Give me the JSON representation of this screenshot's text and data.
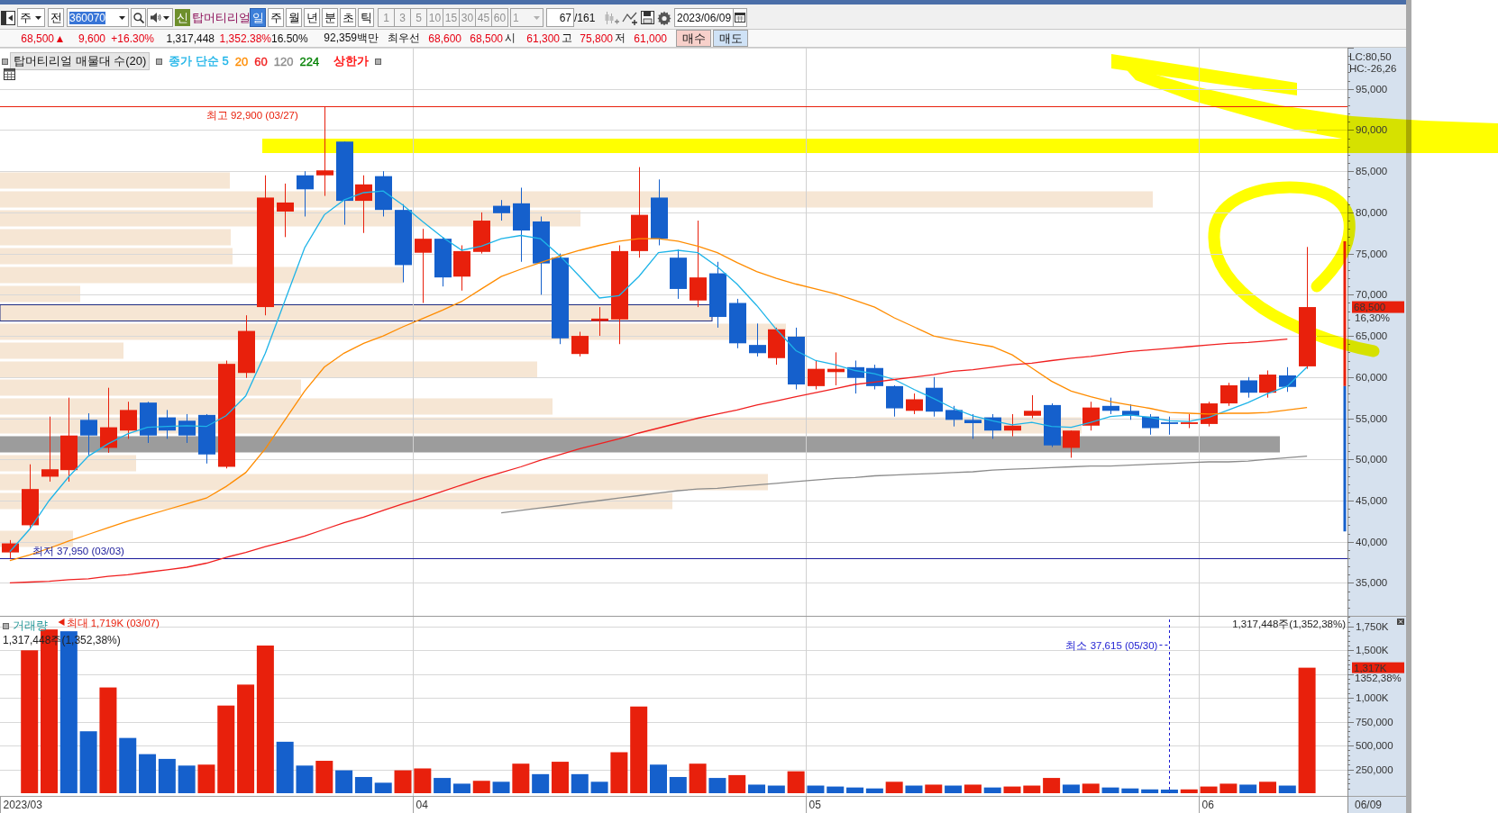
{
  "toolbar": {
    "market_dropdown": {
      "value": "주"
    },
    "full_button": {
      "label": "전"
    },
    "code_field": {
      "value": "360070",
      "text_selected": true
    },
    "badge": {
      "label": "신"
    },
    "stock_name": "탑머티리얼",
    "period_tabs": [
      {
        "label": "일",
        "selected": true
      },
      {
        "label": "주",
        "selected": false
      },
      {
        "label": "월",
        "selected": false
      },
      {
        "label": "년",
        "selected": false
      }
    ],
    "unit_tabs": [
      {
        "label": "분",
        "selected": false
      },
      {
        "label": "초",
        "selected": false
      },
      {
        "label": "틱",
        "selected": false
      }
    ],
    "interval_buttons": [
      {
        "label": "1",
        "disabled": true
      },
      {
        "label": "3",
        "disabled": true
      },
      {
        "label": "5",
        "disabled": true
      },
      {
        "label": "10",
        "disabled": true
      },
      {
        "label": "15",
        "disabled": true
      },
      {
        "label": "30",
        "disabled": true
      },
      {
        "label": "45",
        "disabled": true
      },
      {
        "label": "60",
        "disabled": true
      }
    ],
    "interval_dropdown": {
      "value": "1",
      "disabled": true
    },
    "count_field": {
      "value": "67"
    },
    "count_total": "/161",
    "date_field": {
      "value": "2023/06/09"
    }
  },
  "quote_bar": {
    "price": "68,500",
    "arrow": "▲",
    "change": "9,600",
    "change_rate": "+16.30%",
    "volume": "1,317,448",
    "volume_rate": "1,352.38%",
    "turnover_rate": "16.50%",
    "trade_amount": "92,359백만",
    "best_quote_label": "최우선",
    "best_ask": "68,600",
    "best_bid": "68,500",
    "open_label": "시",
    "open": "61,300",
    "high_label": "고",
    "high": "75,800",
    "low_label": "저",
    "low": "61,000",
    "buttons": [
      {
        "label": "매수",
        "kind": "buy"
      },
      {
        "label": "매도",
        "kind": "sell"
      }
    ]
  },
  "legend": {
    "overlay_label": "탑머티리얼 매물대 수(20)",
    "items": [
      {
        "label": "224",
        "color": "#008000"
      },
      {
        "label": "상한가",
        "color": "#ff0000"
      }
    ]
  },
  "price_chart": {
    "lc": "LC:80,50",
    "hc": "HC:-26,26",
    "price_tag": "68,500",
    "change_tag": "16,30%",
    "chart_data": {
      "type": "candlestick",
      "ylim": [
        31000,
        100000
      ],
      "grid": true,
      "yticks": [
        {
          "value": 35000,
          "label": "35,000"
        },
        {
          "value": 40000,
          "label": "40,000"
        },
        {
          "value": 45000,
          "label": "45,000"
        },
        {
          "value": 50000,
          "label": "50,000"
        },
        {
          "value": 55000,
          "label": "55,000"
        },
        {
          "value": 60000,
          "label": "60,000"
        },
        {
          "value": 65000,
          "label": "65,000"
        },
        {
          "value": 70000,
          "label": "70,000"
        },
        {
          "value": 75000,
          "label": "75,000"
        },
        {
          "value": 80000,
          "label": "80,000"
        },
        {
          "value": 85000,
          "label": "85,000"
        },
        {
          "value": 90000,
          "label": "90,000"
        },
        {
          "value": 95000,
          "label": "95,000"
        }
      ],
      "ohlc": [
        [
          38700,
          40200,
          37950,
          39800
        ],
        [
          42000,
          49400,
          41500,
          46400
        ],
        [
          47900,
          55200,
          47300,
          48800
        ],
        [
          48700,
          57500,
          47300,
          52900
        ],
        [
          54800,
          55600,
          50500,
          52900
        ],
        [
          51400,
          58700,
          50800,
          53900
        ],
        [
          53500,
          57000,
          52500,
          56000
        ],
        [
          56900,
          57000,
          52000,
          52900
        ],
        [
          55100,
          56000,
          52500,
          53500
        ],
        [
          54700,
          55500,
          52000,
          52900
        ],
        [
          55400,
          55500,
          49500,
          50600
        ],
        [
          49100,
          62000,
          48900,
          61600
        ],
        [
          60500,
          67500,
          59900,
          65600
        ],
        [
          68500,
          84500,
          67500,
          81800
        ],
        [
          80100,
          83500,
          77000,
          81200
        ],
        [
          84500,
          85000,
          79500,
          82800
        ],
        [
          84500,
          92900,
          82000,
          85100
        ],
        [
          88600,
          88600,
          78500,
          81400
        ],
        [
          81400,
          84500,
          77500,
          83400
        ],
        [
          84400,
          85000,
          79500,
          80300
        ],
        [
          80300,
          81000,
          71500,
          73600
        ],
        [
          75100,
          78000,
          69000,
          76800
        ],
        [
          76800,
          77000,
          71000,
          72100
        ],
        [
          72200,
          76000,
          70500,
          75300
        ],
        [
          75200,
          80000,
          75000,
          79000
        ],
        [
          80800,
          81500,
          79000,
          79900
        ],
        [
          81100,
          83000,
          74000,
          77800
        ],
        [
          78900,
          79500,
          70000,
          73800
        ],
        [
          74500,
          75000,
          64000,
          64700
        ],
        [
          62800,
          65500,
          62500,
          65000
        ],
        [
          66800,
          68500,
          65000,
          67100
        ],
        [
          67000,
          76000,
          64000,
          75300
        ],
        [
          75300,
          85500,
          74500,
          79700
        ],
        [
          81800,
          84000,
          76000,
          76800
        ],
        [
          74500,
          75500,
          69500,
          70700
        ],
        [
          69300,
          79000,
          68500,
          72100
        ],
        [
          72600,
          74000,
          66000,
          67300
        ],
        [
          69000,
          69500,
          63500,
          64100
        ],
        [
          63900,
          66500,
          62500,
          62900
        ],
        [
          62300,
          66000,
          61500,
          65800
        ],
        [
          64900,
          66000,
          58500,
          59100
        ],
        [
          58900,
          62000,
          58500,
          61000
        ],
        [
          60600,
          63000,
          59000,
          61000
        ],
        [
          61200,
          62000,
          58000,
          59900
        ],
        [
          61100,
          61500,
          58500,
          58900
        ],
        [
          58900,
          59000,
          55200,
          56200
        ],
        [
          55900,
          58000,
          55500,
          57300
        ],
        [
          58700,
          60000,
          55200,
          55800
        ],
        [
          56000,
          56500,
          54000,
          54800
        ],
        [
          54800,
          55500,
          52500,
          54400
        ],
        [
          55100,
          55500,
          52500,
          53500
        ],
        [
          53500,
          55500,
          52800,
          54100
        ],
        [
          55300,
          57800,
          55000,
          55900
        ],
        [
          56600,
          56800,
          51500,
          51700
        ],
        [
          51400,
          53500,
          50200,
          53500
        ],
        [
          54100,
          57000,
          53500,
          56300
        ],
        [
          56500,
          57500,
          55500,
          55900
        ],
        [
          55900,
          56700,
          54800,
          55300
        ],
        [
          55200,
          55500,
          53000,
          53800
        ],
        [
          54500,
          55200,
          53000,
          54300
        ],
        [
          54300,
          55500,
          53800,
          54500
        ],
        [
          54300,
          57000,
          54000,
          56800
        ],
        [
          56800,
          59300,
          56500,
          59000
        ],
        [
          59600,
          60000,
          57500,
          58100
        ],
        [
          58100,
          60800,
          57500,
          60300
        ],
        [
          60200,
          61200,
          58200,
          58800
        ],
        [
          61300,
          75800,
          61000,
          68500
        ]
      ],
      "series": [
        {
          "name": "종가 단순 5",
          "type": "line",
          "color": "#1eb4e8",
          "values": [
            38800,
            41500,
            45000,
            47900,
            50400,
            51900,
            53100,
            53900,
            54000,
            54100,
            54000,
            55300,
            57700,
            62900,
            69300,
            75700,
            79700,
            81500,
            82400,
            82600,
            80900,
            78900,
            77000,
            75400,
            75900,
            76800,
            77200,
            76800,
            74700,
            72200,
            69600,
            69900,
            72200,
            75100,
            75400,
            75100,
            73400,
            71300,
            68700,
            65800,
            63200,
            62000,
            61500,
            60800,
            60400,
            59700,
            58500,
            57400,
            56200,
            55300,
            54700,
            54200,
            54500,
            54000,
            53900,
            54500,
            55200,
            55400,
            55100,
            54700,
            54600,
            55100,
            56000,
            56900,
            58000,
            58900,
            61200
          ]
        },
        {
          "name": "20",
          "type": "line",
          "color": "#ff8c00",
          "values": [
            37700,
            38400,
            39200,
            40100,
            40900,
            41700,
            42500,
            43200,
            43900,
            44600,
            45300,
            46700,
            48400,
            51300,
            54800,
            58300,
            61200,
            62900,
            64100,
            65000,
            66100,
            67100,
            68100,
            69200,
            70700,
            72200,
            73100,
            73900,
            74700,
            75400,
            76000,
            76500,
            76800,
            76800,
            76500,
            75900,
            75100,
            73900,
            72800,
            72000,
            71300,
            70700,
            70100,
            69300,
            68500,
            67200,
            66100,
            65000,
            64500,
            64100,
            63700,
            62700,
            61100,
            59500,
            58300,
            57600,
            57000,
            56600,
            56200,
            55700,
            55600,
            55500,
            55600,
            55600,
            55700,
            56000,
            56300
          ]
        },
        {
          "name": "60",
          "type": "line",
          "color": "#f02020",
          "values": [
            35000,
            35100,
            35200,
            35400,
            35500,
            35800,
            36000,
            36300,
            36600,
            36900,
            37400,
            38100,
            38700,
            39400,
            40000,
            40700,
            41500,
            42300,
            43000,
            43800,
            44600,
            45300,
            46100,
            46900,
            47700,
            48400,
            49100,
            49900,
            50600,
            51300,
            51900,
            52500,
            53200,
            53800,
            54400,
            55000,
            55500,
            56000,
            56600,
            57100,
            57600,
            58100,
            58600,
            59100,
            59400,
            59700,
            60000,
            60300,
            60700,
            60900,
            61200,
            61500,
            61700,
            62000,
            62300,
            62500,
            62800,
            63100,
            63300,
            63500,
            63700,
            63900,
            64100,
            64200,
            64400,
            64600,
            null
          ]
        },
        {
          "name": "120",
          "type": "line",
          "color": "#8c8c8c",
          "values": [
            null,
            null,
            null,
            null,
            null,
            null,
            null,
            null,
            null,
            null,
            null,
            null,
            null,
            null,
            null,
            null,
            null,
            null,
            null,
            null,
            null,
            null,
            null,
            null,
            null,
            43500,
            43800,
            44100,
            44400,
            44700,
            45000,
            45300,
            45600,
            45900,
            46200,
            46400,
            46500,
            46700,
            46900,
            47100,
            47300,
            47500,
            47700,
            47800,
            48000,
            48100,
            48200,
            48300,
            48400,
            48500,
            48700,
            48800,
            48900,
            49000,
            49100,
            49200,
            49200,
            49300,
            49400,
            49500,
            49600,
            49700,
            49700,
            49800,
            50000,
            50200,
            50400
          ]
        }
      ],
      "ref_lines": [
        {
          "axis": "y",
          "value": 92900,
          "label": "최고 92,900 (03/27)",
          "color": "#e8200c"
        },
        {
          "axis": "y",
          "value": 37950,
          "label": "최저 37,950 (03/03)",
          "color": "#1a1a9a"
        }
      ]
    }
  },
  "volume_chart": {
    "summary": "1,317,448주(1,352,38%)",
    "summary_right": "1,317,448주(1,352,38%)",
    "volume_tag": "1,317K",
    "rate_tag": "1352,38%",
    "chart_data": {
      "type": "bar",
      "ylim": [
        0,
        1862000
      ],
      "grid": true,
      "yticks": [
        {
          "value": 250000,
          "label": "250,000"
        },
        {
          "value": 500000,
          "label": "500,000"
        },
        {
          "value": 750000,
          "label": "750,000"
        },
        {
          "value": 1000000,
          "label": "1,000K"
        },
        {
          "value": 1500000,
          "label": "1,500K"
        },
        {
          "value": 1750000,
          "label": "1,750K"
        }
      ],
      "series": [
        {
          "name": "거래량",
          "values": [
            null,
            1500000,
            1719000,
            1700000,
            650000,
            1110000,
            580000,
            410000,
            360000,
            290000,
            300000,
            920000,
            1140000,
            1550000,
            540000,
            290000,
            340000,
            240000,
            170000,
            110000,
            240000,
            260000,
            160000,
            100000,
            130000,
            120000,
            310000,
            200000,
            330000,
            200000,
            120000,
            430000,
            910000,
            300000,
            170000,
            310000,
            160000,
            190000,
            90000,
            80000,
            230000,
            80000,
            70000,
            60000,
            50000,
            120000,
            80000,
            90000,
            80000,
            90000,
            60000,
            70000,
            80000,
            160000,
            90000,
            100000,
            60000,
            50000,
            40000,
            37615,
            40000,
            70000,
            100000,
            90000,
            120000,
            80000,
            1317448
          ]
        }
      ],
      "annotations": [
        "최대 1,719K (03/07)",
        "최소 37,615 (05/30)"
      ]
    }
  },
  "date_axis": {
    "labels": [
      "2023/03",
      "04",
      "05",
      "06"
    ],
    "current_date": "06/09"
  }
}
